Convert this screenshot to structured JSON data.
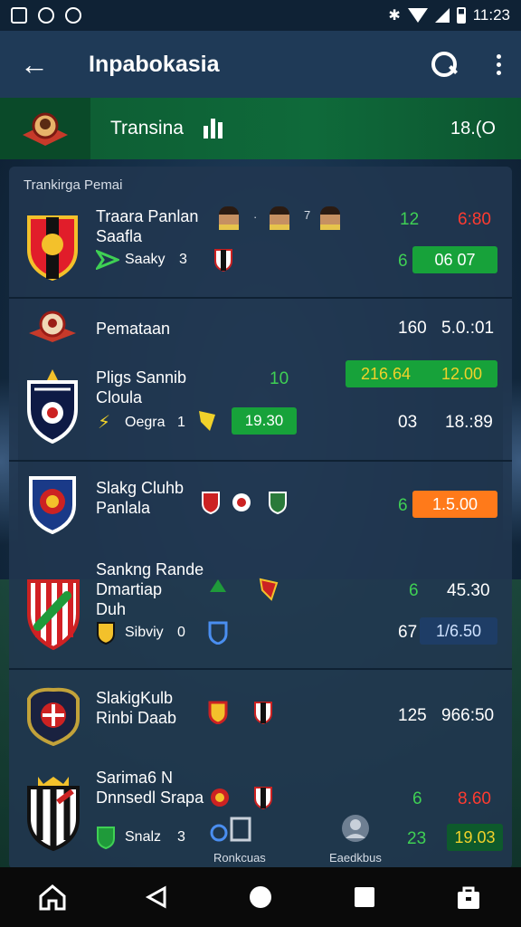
{
  "status_bar": {
    "time": "11:23"
  },
  "app_bar": {
    "title": "Inpabokasia"
  },
  "banner": {
    "title": "Transina",
    "value": "18.(O"
  },
  "panel": {
    "section_label": "Trankirga Pemai",
    "cards": [
      {
        "name_lines": [
          "Traara Panlan",
          "Saafla"
        ],
        "sub_label": "Saaky",
        "sub_value": "3",
        "stat_top_left": "12",
        "stat_top_right": "6:80",
        "stat_bottom_left": "6",
        "pill": "06 07",
        "player_sep_1": "·",
        "player_sep_2": "7"
      },
      {
        "name_lines": [
          "Pemataan"
        ],
        "stat_a": "160",
        "stat_b": "5.0.:01"
      },
      {
        "name_lines": [
          "Pligs Sannib",
          "Cloula"
        ],
        "stat_mid": "10",
        "pill_left": "216.64",
        "pill_right": "12.00",
        "sub_label": "Oegra",
        "sub_value": "1",
        "pill_small": "19.30",
        "stat_bottom_left": "03",
        "stat_bottom_right": "18.:89"
      },
      {
        "name_lines": [
          "Slakg Cluhb",
          "Panlala"
        ],
        "stat_left": "6",
        "pill": "1.5.00"
      },
      {
        "name_lines": [
          "Sankng Rande",
          "Dmartiap",
          "Duh"
        ],
        "stat_left": "6",
        "stat_right": "45.30",
        "sub_label": "Sibviy",
        "sub_value": "0",
        "stat_bottom_left": "67",
        "pill": "1/6.50"
      },
      {
        "name_lines": [
          "SlakigKulb",
          "Rinbi Daab"
        ],
        "stat_left": "125",
        "stat_right": "966:50"
      },
      {
        "name_lines": [
          "Sarima6 N",
          "Dnnsedl Srapa"
        ],
        "stat_left": "6",
        "stat_right": "8.60",
        "sub_label": "Snalz",
        "sub_value": "3",
        "stat_bottom_left": "23",
        "pill": "19.03"
      }
    ],
    "bottom_labels": {
      "rankings": "Ronkcuas",
      "profile": "Eaedkbus"
    }
  },
  "colors": {
    "accent_green": "#3fd054",
    "accent_red": "#ff3b30",
    "accent_orange": "#ff7a1a",
    "pill_green": "#17a23a",
    "pill_blue": "#1e3d66"
  },
  "icons": {
    "back": "back-arrow-icon",
    "search": "search-icon",
    "more": "more-vertical-icon",
    "nav": [
      "home-icon",
      "back-triangle-icon",
      "circle-home-icon",
      "square-recents-icon",
      "bag-icon"
    ]
  }
}
